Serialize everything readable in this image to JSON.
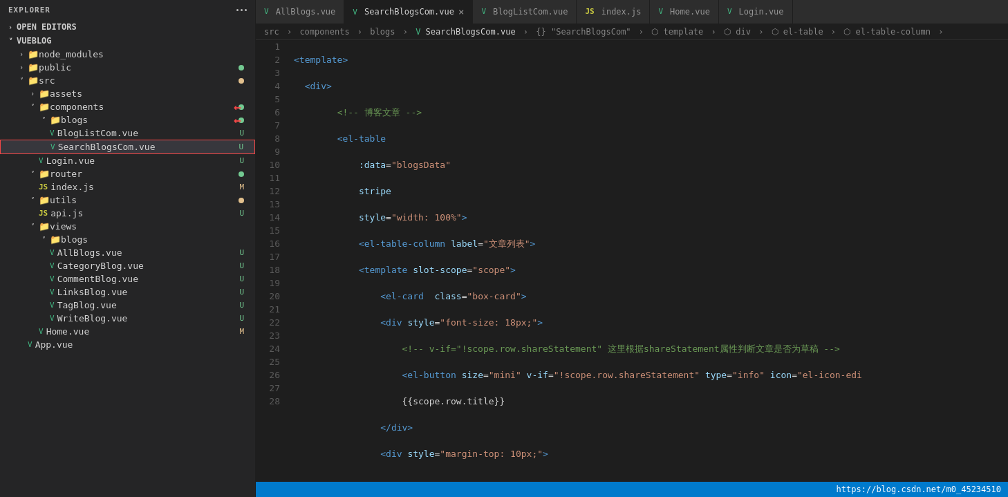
{
  "sidebar": {
    "title": "EXPLORER",
    "sections": {
      "open_editors": "OPEN EDITORS",
      "vueblog": "VUEBLOG"
    },
    "tree": [
      {
        "id": "node_modules",
        "label": "node_modules",
        "indent": 1,
        "type": "folder",
        "collapsed": true,
        "badge": null
      },
      {
        "id": "public",
        "label": "public",
        "indent": 1,
        "type": "folder",
        "collapsed": true,
        "badge": "dot-green"
      },
      {
        "id": "src",
        "label": "src",
        "indent": 1,
        "type": "folder",
        "collapsed": false,
        "badge": "dot-yellow"
      },
      {
        "id": "assets",
        "label": "assets",
        "indent": 2,
        "type": "folder",
        "collapsed": true,
        "badge": null
      },
      {
        "id": "components",
        "label": "components",
        "indent": 2,
        "type": "folder",
        "collapsed": false,
        "badge": "dot-green",
        "arrow": true
      },
      {
        "id": "blogs-folder",
        "label": "blogs",
        "indent": 3,
        "type": "folder",
        "collapsed": false,
        "badge": "dot-green",
        "arrow": true
      },
      {
        "id": "BlogListCom",
        "label": "BlogListCom.vue",
        "indent": 4,
        "type": "vue",
        "badge": "U"
      },
      {
        "id": "SearchBlogsCom",
        "label": "SearchBlogsCom.vue",
        "indent": 4,
        "type": "vue",
        "badge": "U",
        "active": true
      },
      {
        "id": "Login",
        "label": "Login.vue",
        "indent": 3,
        "type": "vue",
        "badge": "U"
      },
      {
        "id": "router",
        "label": "router",
        "indent": 2,
        "type": "folder",
        "collapsed": true,
        "badge": "dot-green"
      },
      {
        "id": "index-js",
        "label": "index.js",
        "indent": 3,
        "type": "js",
        "badge": "M"
      },
      {
        "id": "utils",
        "label": "utils",
        "indent": 2,
        "type": "folder",
        "collapsed": true,
        "badge": "dot-yellow"
      },
      {
        "id": "api-js",
        "label": "api.js",
        "indent": 3,
        "type": "js",
        "badge": "U"
      },
      {
        "id": "views",
        "label": "views",
        "indent": 2,
        "type": "folder",
        "collapsed": false,
        "badge": null
      },
      {
        "id": "views-blogs",
        "label": "blogs",
        "indent": 3,
        "type": "folder",
        "collapsed": false,
        "badge": null
      },
      {
        "id": "AllBlogs",
        "label": "AllBlogs.vue",
        "indent": 4,
        "type": "vue",
        "badge": "U"
      },
      {
        "id": "CategoryBlog",
        "label": "CategoryBlog.vue",
        "indent": 4,
        "type": "vue",
        "badge": "U"
      },
      {
        "id": "CommentBlog",
        "label": "CommentBlog.vue",
        "indent": 4,
        "type": "vue",
        "badge": "U"
      },
      {
        "id": "LinksBlog",
        "label": "LinksBlog.vue",
        "indent": 4,
        "type": "vue",
        "badge": "U"
      },
      {
        "id": "TagBlog",
        "label": "TagBlog.vue",
        "indent": 4,
        "type": "vue",
        "badge": "U"
      },
      {
        "id": "WriteBlog",
        "label": "WriteBlog.vue",
        "indent": 4,
        "type": "vue",
        "badge": "U"
      },
      {
        "id": "Home-vue",
        "label": "Home.vue",
        "indent": 3,
        "type": "vue",
        "badge": "M"
      },
      {
        "id": "App-vue",
        "label": "App.vue",
        "indent": 2,
        "type": "vue",
        "badge": null
      }
    ]
  },
  "tabs": [
    {
      "id": "allblogs",
      "label": "AllBlogs.vue",
      "type": "vue",
      "active": false,
      "closable": false
    },
    {
      "id": "searchblogs",
      "label": "SearchBlogsCom.vue",
      "type": "vue",
      "active": true,
      "closable": true
    },
    {
      "id": "bloglistcom",
      "label": "BlogListCom.vue",
      "type": "vue",
      "active": false,
      "closable": false
    },
    {
      "id": "indexjs",
      "label": "index.js",
      "type": "js",
      "active": false,
      "closable": false
    },
    {
      "id": "homevue",
      "label": "Home.vue",
      "type": "vue",
      "active": false,
      "closable": false
    },
    {
      "id": "loginvue",
      "label": "Login.vue",
      "type": "vue",
      "active": false,
      "closable": false
    }
  ],
  "breadcrumb": "src > components > blogs > SearchBlogsCom.vue > {} \"SearchBlogsCom\" > template > div > el-table > el-table-column >",
  "status": "https://blog.csdn.net/m0_45234510",
  "lines": [
    1,
    2,
    3,
    4,
    5,
    6,
    7,
    8,
    9,
    10,
    11,
    12,
    13,
    14,
    15,
    16,
    17,
    18,
    19,
    20,
    21,
    22,
    23,
    24,
    25,
    26,
    27,
    28
  ]
}
